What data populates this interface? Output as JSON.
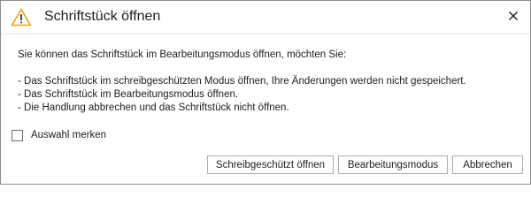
{
  "dialog": {
    "title": "Schriftstück öffnen",
    "icon": "warning-icon",
    "close_icon": "close-icon",
    "accent": "#e8a317"
  },
  "message": {
    "intro": "Sie können das Schriftstück im Bearbeitungsmodus öffnen, möchten Sie:",
    "options": [
      "- Das Schriftstück im schreibgeschützten Modus öffnen, Ihre Änderungen werden nicht gespeichert.",
      "- Das Schriftstück im Bearbeitungsmodus öffnen.",
      "- Die Handlung abbrechen und das Schriftstück nicht öffnen."
    ]
  },
  "remember": {
    "label": "Auswahl merken",
    "checked": false
  },
  "buttons": {
    "readonly": "Schreibgeschützt öffnen",
    "edit": "Bearbeitungsmodus",
    "cancel": "Abbrechen"
  }
}
